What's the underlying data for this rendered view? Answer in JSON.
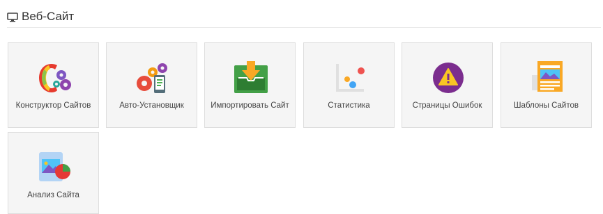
{
  "section": {
    "title": "Веб-Сайт",
    "icon": "monitor-icon"
  },
  "tiles": [
    {
      "label": "Конструктор Сайтов",
      "icon": "site-builder-icon"
    },
    {
      "label": "Авто-Установщик",
      "icon": "auto-installer-icon"
    },
    {
      "label": "Импортировать Сайт",
      "icon": "import-site-icon"
    },
    {
      "label": "Статистика",
      "icon": "statistics-icon"
    },
    {
      "label": "Страницы Ошибок",
      "icon": "error-pages-icon"
    },
    {
      "label": "Шаблоны Сайтов",
      "icon": "site-templates-icon"
    },
    {
      "label": "Анализ Сайта",
      "icon": "site-analysis-icon"
    }
  ],
  "colors": {
    "tile_background": "#f5f5f5",
    "tile_border": "#dedede",
    "header_rule": "#e8e8e8"
  }
}
